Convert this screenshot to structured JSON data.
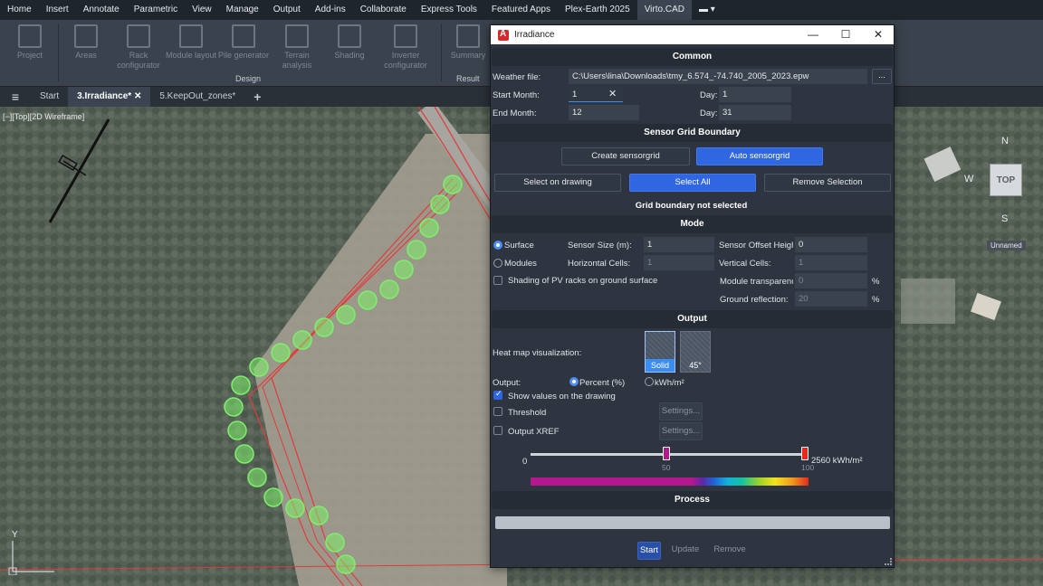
{
  "menu": [
    "Home",
    "Insert",
    "Annotate",
    "Parametric",
    "View",
    "Manage",
    "Output",
    "Add-ins",
    "Collaborate",
    "Express Tools",
    "Featured Apps",
    "Plex-Earth 2025",
    "Virto.CAD"
  ],
  "menu_active": "Virto.CAD",
  "ribbon": {
    "buttons": [
      {
        "label": "Project",
        "icon": "project-icon"
      },
      {
        "label": "Areas",
        "icon": "areas-icon"
      },
      {
        "label": "Rack configurator",
        "icon": "rack-icon"
      },
      {
        "label": "Module layout",
        "icon": "module-layout-icon"
      },
      {
        "label": "Pile generator",
        "icon": "pile-icon"
      },
      {
        "label": "Terrain analysis",
        "icon": "terrain-icon"
      },
      {
        "label": "Shading",
        "icon": "shading-icon"
      },
      {
        "label": "Inverter configurator",
        "icon": "inverter-icon"
      },
      {
        "label": "Summary",
        "icon": "summary-icon"
      }
    ],
    "group_design": "Design",
    "group_result": "Result"
  },
  "tabs": {
    "start": "Start",
    "irradiance": "3.Irradiance*",
    "keepout": "5.KeepOut_zones*",
    "add": "+"
  },
  "viewport": {
    "label": "[−][Top][2D Wireframe]",
    "cube": "TOP",
    "n": "N",
    "w": "W",
    "s": "S",
    "unnamed": "Unnamed",
    "axis_y": "Y"
  },
  "dialog": {
    "title": "Irradiance",
    "common": {
      "header": "Common",
      "weather_label": "Weather file:",
      "weather_value": "C:\\Users\\lina\\Downloads\\tmy_6.574_-74.740_2005_2023.epw",
      "browse": "...",
      "start_month_label": "Start Month:",
      "start_month_value": "1",
      "end_month_label": "End Month:",
      "end_month_value": "12",
      "day1_label": "Day:",
      "day1_value": "1",
      "day2_label": "Day:",
      "day2_value": "31"
    },
    "sensor": {
      "header": "Sensor Grid Boundary",
      "create": "Create sensorgrid",
      "auto": "Auto sensorgrid",
      "select_drawing": "Select on drawing",
      "select_all": "Select All",
      "remove": "Remove Selection",
      "status": "Grid boundary not selected"
    },
    "mode": {
      "header": "Mode",
      "surface": "Surface",
      "modules": "Modules",
      "sensor_size_label": "Sensor Size (m):",
      "sensor_size_value": "1",
      "horiz_label": "Horizontal Cells:",
      "horiz_value": "1",
      "offset_label": "Sensor Offset Heigh",
      "offset_value": "0",
      "vert_label": "Vertical Cells:",
      "vert_value": "1",
      "shading_label": "Shading of PV racks on ground surface",
      "transp_label": "Module transparenc",
      "transp_value": "0",
      "ground_label": "Ground reflection:",
      "ground_value": "20",
      "pct": "%"
    },
    "output": {
      "header": "Output",
      "heatmap_label": "Heat map visualization:",
      "solid": "Solid",
      "deg45": "45°",
      "output_label": "Output:",
      "percent": "Percent (%)",
      "kwh": "kWh/m²",
      "show_values": "Show values on the drawing",
      "threshold": "Threshold",
      "settings1": "Settings...",
      "xref": "Output XREF",
      "settings2": "Settings...",
      "scale_min": "0",
      "scale_mid": "50",
      "scale_max": "100",
      "scale_value": "2560 kWh/m²"
    },
    "process": {
      "header": "Process",
      "start": "Start",
      "update": "Update",
      "remove": "Remove"
    }
  },
  "colors": {
    "accent": "#2f67e2",
    "marker": "#7df06a",
    "boundary": "#e23a3a"
  }
}
